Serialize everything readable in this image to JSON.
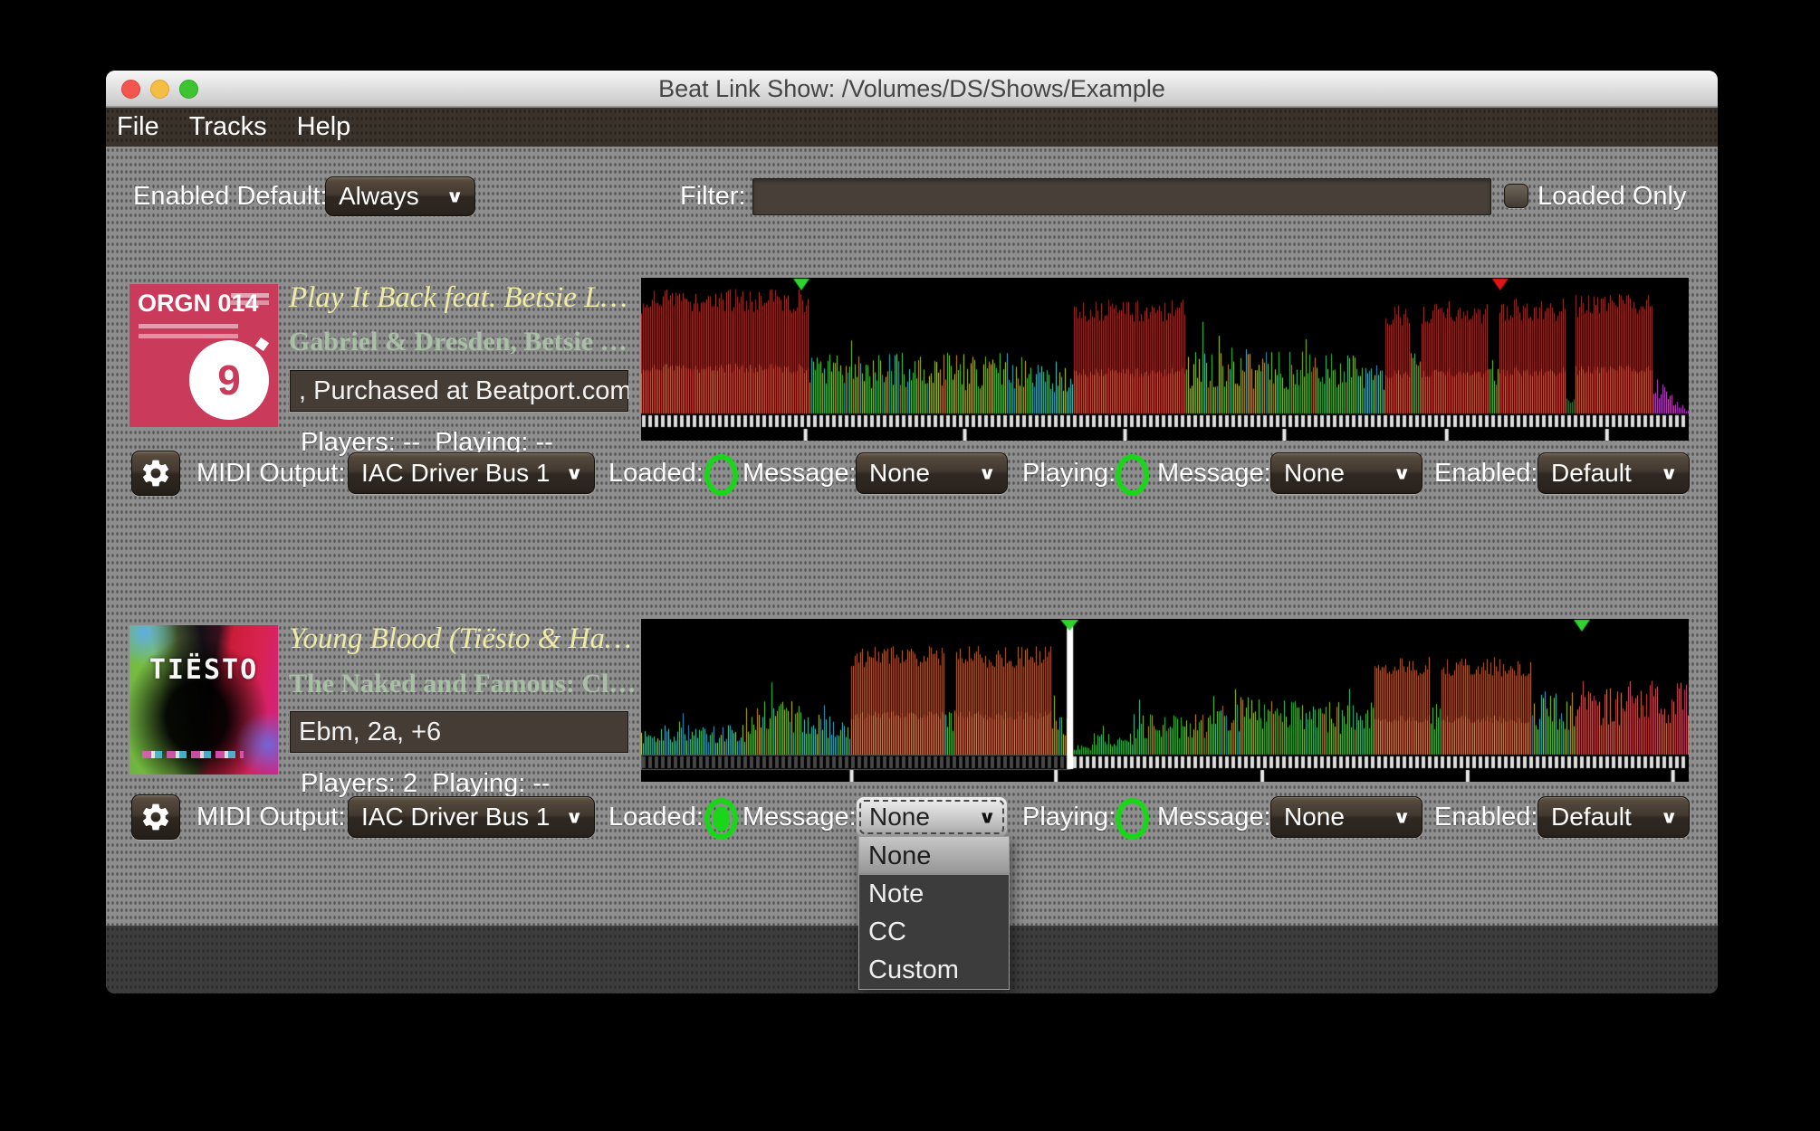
{
  "window": {
    "title": "Beat Link Show: /Volumes/DS/Shows/Example"
  },
  "menu_bar": {
    "items": [
      "File",
      "Tracks",
      "Help"
    ]
  },
  "filter_bar": {
    "enabled_default_label": "Enabled Default:",
    "enabled_default_value": "Always",
    "filter_label": "Filter:",
    "filter_value": "",
    "loaded_only_label": "Loaded Only",
    "loaded_only_checked": false
  },
  "indicator_color": "#1bd51b",
  "message_menu": {
    "options": [
      "None",
      "Note",
      "CC",
      "Custom"
    ],
    "selected_index": 0
  },
  "tracks": [
    {
      "art": {
        "style": "orgn",
        "label": "ORGN 014",
        "logo_char": "9"
      },
      "title": "Play It Back feat. Betsie L…",
      "artist": "Gabriel & Dresden, Betsie …",
      "comment": ", Purchased at Beatport.com",
      "players_label": "Players:",
      "players_value": "--",
      "playing_label": "Playing:",
      "playing_value": "--",
      "controls": {
        "midi_output_label": "MIDI Output:",
        "midi_output_value": "IAC Driver Bus 1",
        "loaded_label": "Loaded:",
        "loaded_on": false,
        "loaded_message_label": "Message:",
        "loaded_message_value": "None",
        "playing_label": "Playing:",
        "playing_on": false,
        "playing_message_label": "Message:",
        "playing_message_value": "None",
        "enabled_label": "Enabled:",
        "enabled_value": "Default"
      },
      "waveform": {
        "markers": [
          {
            "pos": 0.153,
            "color": "#2fd42f"
          },
          {
            "pos": 0.82,
            "color": "#e01414"
          }
        ],
        "playhead": null,
        "ruler_dim_before": 0,
        "minute_ticks": [
          0.157,
          0.309,
          0.462,
          0.614,
          0.769,
          0.922
        ],
        "segments": [
          {
            "from": 0.0,
            "to": 0.16,
            "type": "loud_red",
            "h": 0.92
          },
          {
            "from": 0.16,
            "to": 0.37,
            "type": "mix_warm",
            "h": 0.45
          },
          {
            "from": 0.37,
            "to": 0.412,
            "type": "mix_cool",
            "h": 0.4
          },
          {
            "from": 0.412,
            "to": 0.52,
            "type": "loud_red",
            "h": 0.84
          },
          {
            "from": 0.52,
            "to": 0.61,
            "type": "mix_warm",
            "h": 0.48
          },
          {
            "from": 0.61,
            "to": 0.684,
            "type": "mix_green",
            "h": 0.46
          },
          {
            "from": 0.684,
            "to": 0.71,
            "type": "mix_cool",
            "h": 0.36
          },
          {
            "from": 0.71,
            "to": 0.734,
            "type": "loud_red",
            "h": 0.8
          },
          {
            "from": 0.734,
            "to": 0.745,
            "type": "mix_green",
            "h": 0.45
          },
          {
            "from": 0.745,
            "to": 0.808,
            "type": "loud_red",
            "h": 0.83
          },
          {
            "from": 0.808,
            "to": 0.818,
            "type": "mix_green",
            "h": 0.5
          },
          {
            "from": 0.818,
            "to": 0.883,
            "type": "loud_red",
            "h": 0.85
          },
          {
            "from": 0.883,
            "to": 0.891,
            "type": "quiet",
            "h": 0.12
          },
          {
            "from": 0.891,
            "to": 0.966,
            "type": "loud_red",
            "h": 0.88
          },
          {
            "from": 0.966,
            "to": 1.0,
            "type": "fade_purple",
            "h": 0.3
          }
        ]
      }
    },
    {
      "art": {
        "style": "tiesto",
        "label": "TIËSTO"
      },
      "title": "Young Blood (Tiësto & Ha…",
      "artist": "The Naked and Famous: Cl…",
      "comment": "Ebm, 2a, +6",
      "players_label": "Players:",
      "players_value": "2",
      "playing_label": "Playing:",
      "playing_value": "--",
      "controls": {
        "midi_output_label": "MIDI Output:",
        "midi_output_value": "IAC Driver Bus 1",
        "loaded_label": "Loaded:",
        "loaded_on": true,
        "loaded_message_label": "Message:",
        "loaded_message_value": "None",
        "playing_label": "Playing:",
        "playing_on": false,
        "playing_message_label": "Message:",
        "playing_message_value": "None",
        "enabled_label": "Enabled:",
        "enabled_value": "Default"
      },
      "waveform": {
        "markers": [
          {
            "pos": 0.898,
            "color": "#2fd42f"
          }
        ],
        "playhead": {
          "pos": 0.409,
          "color": "#ffffff",
          "cap_color": "#2fd42f"
        },
        "ruler_dim_before": 0.409,
        "minute_ticks": [
          0.201,
          0.396,
          0.593,
          0.789,
          0.985
        ],
        "segments": [
          {
            "from": 0.0,
            "to": 0.1,
            "type": "mix_cool",
            "h": 0.22
          },
          {
            "from": 0.1,
            "to": 0.155,
            "type": "mix_warm",
            "h": 0.4
          },
          {
            "from": 0.155,
            "to": 0.2,
            "type": "mix_cool",
            "h": 0.3
          },
          {
            "from": 0.2,
            "to": 0.29,
            "type": "loud_orange",
            "h": 0.8
          },
          {
            "from": 0.29,
            "to": 0.3,
            "type": "mix_warm",
            "h": 0.35
          },
          {
            "from": 0.3,
            "to": 0.392,
            "type": "loud_orange",
            "h": 0.8
          },
          {
            "from": 0.392,
            "to": 0.409,
            "type": "mix_warm",
            "h": 0.32
          },
          {
            "from": 0.409,
            "to": 0.43,
            "type": "quiet_green",
            "h": 0.07
          },
          {
            "from": 0.43,
            "to": 0.47,
            "type": "quiet_green",
            "h": 0.16
          },
          {
            "from": 0.47,
            "to": 0.545,
            "type": "mix_green",
            "h": 0.3
          },
          {
            "from": 0.545,
            "to": 0.59,
            "type": "mix_warm",
            "h": 0.45
          },
          {
            "from": 0.59,
            "to": 0.7,
            "type": "mix_green",
            "h": 0.4
          },
          {
            "from": 0.7,
            "to": 0.752,
            "type": "loud_orange",
            "h": 0.72
          },
          {
            "from": 0.752,
            "to": 0.764,
            "type": "mix_green",
            "h": 0.4
          },
          {
            "from": 0.764,
            "to": 0.85,
            "type": "loud_orange",
            "h": 0.72
          },
          {
            "from": 0.85,
            "to": 0.891,
            "type": "mix_warm",
            "h": 0.48
          },
          {
            "from": 0.891,
            "to": 1.0,
            "type": "mix_red",
            "h": 0.55
          }
        ]
      }
    }
  ]
}
